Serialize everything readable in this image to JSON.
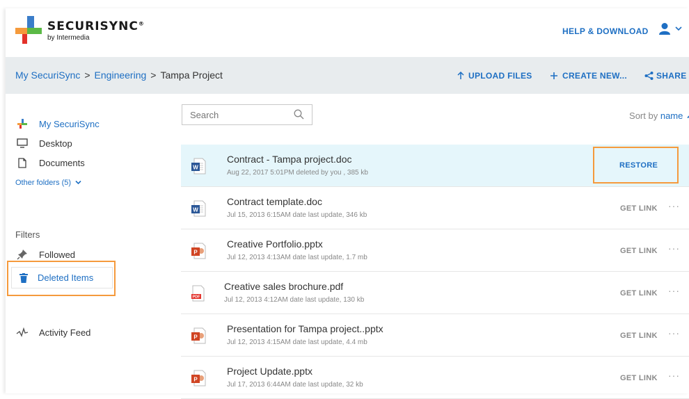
{
  "brand": {
    "name": "SECURISYNC",
    "reg": "®",
    "by": "by Intermedia"
  },
  "header": {
    "help_label": "HELP & DOWNLOAD"
  },
  "breadcrumbs": {
    "root": "My SecuriSync",
    "sep1": ">",
    "parent": "Engineering",
    "sep2": ">",
    "current": "Tampa Project"
  },
  "actions": {
    "upload": "UPLOAD FILES",
    "create": "CREATE NEW...",
    "share": "SHARE"
  },
  "sidebar": {
    "items": [
      {
        "label": "My SecuriSync",
        "icon": "securisync-icon"
      },
      {
        "label": "Desktop",
        "icon": "monitor-icon"
      },
      {
        "label": "Documents",
        "icon": "document-icon"
      }
    ],
    "other_folders": "Other folders (5)",
    "filters_heading": "Filters",
    "followed": "Followed",
    "deleted": "Deleted Items",
    "activity": "Activity Feed"
  },
  "search": {
    "placeholder": "Search"
  },
  "sort": {
    "prefix": "Sort by",
    "field": "name"
  },
  "files": [
    {
      "name": "Contract - Tampa project.doc",
      "meta": "Aug 22, 2017 5:01PM deleted by you , 385 kb",
      "type": "word",
      "action": "RESTORE",
      "selected": true
    },
    {
      "name": "Contract template.doc",
      "meta": "Jul 15, 2013 6:15AM date last update, 346 kb",
      "type": "word",
      "action": "GET LINK"
    },
    {
      "name": "Creative Portfolio.pptx",
      "meta": "Jul 12, 2013 4:13AM date last update, 1.7 mb",
      "type": "ppt",
      "action": "GET LINK"
    },
    {
      "name": "Creative sales brochure.pdf",
      "meta": "Jul 12, 2013 4:12AM date last update, 130 kb",
      "type": "pdf",
      "action": "GET LINK"
    },
    {
      "name": "Presentation for Tampa project..pptx",
      "meta": "Jul 12, 2013 4:15AM date last update, 4.4 mb",
      "type": "ppt",
      "action": "GET LINK"
    },
    {
      "name": "Project Update.pptx",
      "meta": "Jul 17, 2013 6:44AM date last update, 32 kb",
      "type": "ppt",
      "action": "GET LINK"
    }
  ],
  "more_label": "···",
  "colors": {
    "accent": "#1e6fc3",
    "highlight": "#f59a3c",
    "selected_row": "#e5f6fb",
    "pathbar": "#e8ecee"
  }
}
